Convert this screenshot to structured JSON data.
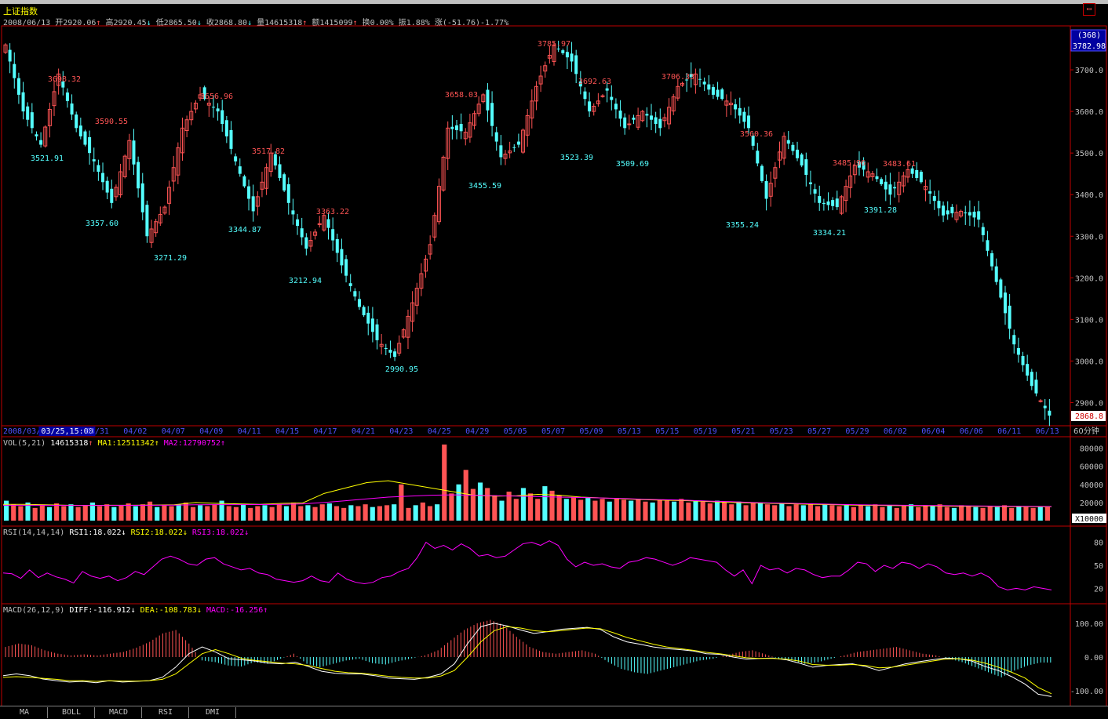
{
  "header": {
    "title": "上证指数",
    "date": "2008/06/13",
    "open": "开2920.06",
    "high": "高2920.45",
    "low": "低2865.50",
    "close": "收2868.80",
    "volume": "量14615318",
    "amount": "额1415099",
    "turnover": "换0.00%",
    "amplitude": "振1.88%",
    "change": "涨(-51.76)-1.77%",
    "count_badge": "(368)",
    "top_price": "3782.98",
    "last_price": "2868.8",
    "period": "60分钟"
  },
  "colors": {
    "up": "#ff5454",
    "down": "#54ffff",
    "ma1": "#ffff00",
    "ma2": "#ff00ff",
    "grid": "#c00000",
    "axis_text": "#c0c0c0"
  },
  "x_axis": {
    "labels": [
      "2008/03/21",
      "03/25,15:00",
      "03/31",
      "04/02",
      "04/07",
      "04/09",
      "04/11",
      "04/15",
      "04/17",
      "04/21",
      "04/23",
      "04/25",
      "04/29",
      "05/05",
      "05/07",
      "05/09",
      "05/13",
      "05/15",
      "05/19",
      "05/21",
      "05/23",
      "05/27",
      "05/29",
      "06/02",
      "06/04",
      "06/06",
      "06/11",
      "06/13"
    ]
  },
  "price_axis": {
    "ticks": [
      "3700.0",
      "3600.0",
      "3500.0",
      "3400.0",
      "3300.0",
      "3200.0",
      "3100.0",
      "3000.0",
      "2900.0"
    ]
  },
  "annotations": [
    {
      "text": "3698.32",
      "type": "high"
    },
    {
      "text": "3521.91",
      "type": "low"
    },
    {
      "text": "3590.55",
      "type": "high"
    },
    {
      "text": "3357.60",
      "type": "low"
    },
    {
      "text": "3271.29",
      "type": "low"
    },
    {
      "text": "3656.96",
      "type": "high"
    },
    {
      "text": "3344.87",
      "type": "low"
    },
    {
      "text": "3517.82",
      "type": "high"
    },
    {
      "text": "3363.22",
      "type": "high"
    },
    {
      "text": "3212.94",
      "type": "low"
    },
    {
      "text": "2990.95",
      "type": "low"
    },
    {
      "text": "3658.03",
      "type": "high"
    },
    {
      "text": "3455.59",
      "type": "low"
    },
    {
      "text": "3785.97",
      "type": "high"
    },
    {
      "text": "3692.63",
      "type": "high"
    },
    {
      "text": "3523.39",
      "type": "low"
    },
    {
      "text": "3509.69",
      "type": "low"
    },
    {
      "text": "3706.33",
      "type": "high"
    },
    {
      "text": "3560.36",
      "type": "high"
    },
    {
      "text": "3355.24",
      "type": "low"
    },
    {
      "text": "3485.96",
      "type": "high"
    },
    {
      "text": "3334.21",
      "type": "low"
    },
    {
      "text": "3483.61",
      "type": "high"
    },
    {
      "text": "3391.28",
      "type": "low"
    }
  ],
  "vol_panel": {
    "legend_name": "VOL(5,21)",
    "value": "14615318",
    "ma1": "MA1:12511342",
    "ma2": "MA2:12790752",
    "ticks": [
      "80000",
      "60000",
      "40000",
      "20000"
    ],
    "unit": "X10000"
  },
  "rsi_panel": {
    "legend_name": "RSI(14,14,14)",
    "rsi1": "RSI1:18.022",
    "rsi2": "RSI2:18.022",
    "rsi3": "RSI3:18.022",
    "ticks": [
      "80",
      "50",
      "20"
    ]
  },
  "macd_panel": {
    "legend_name": "MACD(26,12,9)",
    "diff": "DIFF:-116.912",
    "dea": "DEA:-108.783",
    "macd": "MACD:-16.256",
    "ticks": [
      "100.00",
      "0.00",
      "-100.00"
    ]
  },
  "tabs": [
    "MA",
    "BOLL",
    "MACD",
    "RSI",
    "DMI"
  ],
  "chart_data": [
    {
      "type": "candlestick",
      "title": "上证指数",
      "interval": "60分钟",
      "ylim": [
        2850,
        3800
      ],
      "close_path": [
        [
          "2008/03/21",
          3760
        ],
        [
          "03/25",
          3600
        ],
        [
          "03/25",
          3520
        ],
        [
          "03/27",
          3690
        ],
        [
          "03/31",
          3560
        ],
        [
          "03/31",
          3480
        ],
        [
          "04/01",
          3380
        ],
        [
          "04/02",
          3530
        ],
        [
          "04/02",
          3300
        ],
        [
          "04/03",
          3370
        ],
        [
          "04/07",
          3560
        ],
        [
          "04/07",
          3640
        ],
        [
          "04/08",
          3600
        ],
        [
          "04/09",
          3480
        ],
        [
          "04/10",
          3360
        ],
        [
          "04/11",
          3500
        ],
        [
          "04/14",
          3380
        ],
        [
          "04/15",
          3270
        ],
        [
          "04/16",
          3350
        ],
        [
          "04/17",
          3230
        ],
        [
          "04/18",
          3130
        ],
        [
          "04/21",
          3050
        ],
        [
          "04/22",
          3010
        ],
        [
          "04/22",
          3140
        ],
        [
          "04/23",
          3280
        ],
        [
          "04/24",
          3560
        ],
        [
          "04/25",
          3550
        ],
        [
          "04/25",
          3640
        ],
        [
          "04/28",
          3490
        ],
        [
          "04/29",
          3520
        ],
        [
          "04/30",
          3660
        ],
        [
          "05/05",
          3760
        ],
        [
          "05/06",
          3720
        ],
        [
          "05/07",
          3600
        ],
        [
          "05/08",
          3650
        ],
        [
          "05/09",
          3560
        ],
        [
          "05/12",
          3600
        ],
        [
          "05/13",
          3560
        ],
        [
          "05/14",
          3660
        ],
        [
          "05/15",
          3690
        ],
        [
          "05/16",
          3640
        ],
        [
          "05/19",
          3620
        ],
        [
          "05/20",
          3560
        ],
        [
          "05/21",
          3390
        ],
        [
          "05/22",
          3540
        ],
        [
          "05/23",
          3470
        ],
        [
          "05/26",
          3380
        ],
        [
          "05/27",
          3370
        ],
        [
          "05/28",
          3470
        ],
        [
          "05/29",
          3450
        ],
        [
          "05/30",
          3400
        ],
        [
          "06/02",
          3460
        ],
        [
          "06/03",
          3420
        ],
        [
          "06/04",
          3350
        ],
        [
          "06/05",
          3360
        ],
        [
          "06/06",
          3340
        ],
        [
          "06/10",
          3190
        ],
        [
          "06/11",
          3040
        ],
        [
          "06/12",
          2940
        ],
        [
          "06/13",
          2868.8
        ]
      ]
    },
    {
      "type": "bar",
      "title": "VOL(5,21)",
      "unit": "X10000",
      "ylim": [
        0,
        90000
      ],
      "values": [
        22000,
        18000,
        16000,
        20000,
        14000,
        17000,
        15000,
        19000,
        16000,
        18000,
        15000,
        17000,
        20000,
        16000,
        18000,
        15000,
        17000,
        19000,
        16000,
        18000,
        21000,
        15000,
        17000,
        16000,
        18000,
        20000,
        15000,
        17000,
        16000,
        18000,
        22000,
        16000,
        15000,
        18000,
        14000,
        16000,
        17000,
        15000,
        18000,
        16000,
        20000,
        16000,
        17000,
        15000,
        18000,
        19000,
        16000,
        14000,
        17000,
        16000,
        18000,
        15000,
        16000,
        17000,
        18000,
        40000,
        14000,
        17000,
        20000,
        16000,
        18000,
        84000,
        30000,
        40000,
        56000,
        35000,
        42000,
        36000,
        28000,
        22000,
        32000,
        24000,
        36000,
        30000,
        24000,
        38000,
        33000,
        28000,
        24000,
        26000,
        23000,
        25000,
        22000,
        24000,
        21000,
        25000,
        23000,
        22000,
        24000,
        21000,
        20000,
        23000,
        22000,
        21000,
        24000,
        20000,
        22000,
        21000,
        19000,
        22000,
        20000,
        18000,
        21000,
        17000,
        19000,
        20000,
        18000,
        17000,
        19000,
        16000,
        18000,
        17000,
        19000,
        16000,
        18000,
        17000,
        16000,
        18000,
        15000,
        17000,
        16000,
        18000,
        15000,
        17000,
        14000,
        16000,
        18000,
        15000,
        17000,
        16000,
        18000,
        15000,
        14000,
        17000,
        16000,
        15000,
        14000,
        16000,
        15000,
        17000,
        14000,
        16000,
        15000,
        14000,
        16000,
        15000
      ],
      "series": [
        {
          "name": "MA1",
          "values": [
            18000,
            18000,
            17500,
            17000,
            16800,
            17000,
            17000,
            17200,
            17500,
            20000,
            19000,
            18500,
            18000,
            19000,
            19500,
            30000,
            36000,
            42000,
            44000,
            40000,
            36000,
            32000,
            28000,
            27000,
            27500,
            29000,
            28000,
            26000,
            25000,
            24000,
            23000,
            22500,
            22000,
            21000,
            20000,
            19500,
            19000,
            18500,
            18000,
            17500,
            17000,
            16800,
            16500,
            16300,
            16000,
            15800,
            15800,
            15600,
            15500,
            15300
          ]
        },
        {
          "name": "MA2",
          "values": [
            17000,
            17000,
            17000,
            16800,
            16800,
            16800,
            16900,
            17000,
            17100,
            17500,
            17600,
            17600,
            17700,
            18000,
            18500,
            20000,
            22000,
            24000,
            26000,
            27000,
            28000,
            28500,
            28000,
            27500,
            27000,
            26500,
            26000,
            25500,
            25000,
            24500,
            23500,
            23000,
            22500,
            21500,
            21000,
            20000,
            19500,
            19000,
            18500,
            18000,
            17500,
            17200,
            17000,
            16800,
            16500,
            16300,
            16100,
            16000,
            15800,
            15600
          ]
        }
      ]
    },
    {
      "type": "line",
      "title": "RSI(14,14,14)",
      "ylim": [
        0,
        100
      ],
      "series": [
        {
          "name": "RSI1",
          "values": [
            40,
            39,
            33,
            44,
            34,
            40,
            35,
            32,
            27,
            42,
            36,
            33,
            36,
            30,
            34,
            42,
            38,
            48,
            58,
            62,
            58,
            52,
            50,
            58,
            60,
            52,
            48,
            44,
            46,
            40,
            38,
            32,
            30,
            28,
            30,
            36,
            30,
            28,
            40,
            32,
            28,
            26,
            28,
            34,
            36,
            42,
            46,
            60,
            80,
            72,
            76,
            70,
            78,
            72,
            62,
            64,
            60,
            62,
            70,
            78,
            80,
            76,
            82,
            76,
            58,
            48,
            54,
            50,
            52,
            48,
            46,
            54,
            56,
            60,
            58,
            54,
            50,
            54,
            60,
            58,
            56,
            54,
            44,
            36,
            44,
            26,
            50,
            44,
            46,
            40,
            46,
            44,
            38,
            34,
            36,
            36,
            44,
            54,
            52,
            42,
            50,
            46,
            54,
            52,
            46,
            52,
            48,
            40,
            38,
            40,
            36,
            40,
            34,
            22,
            18,
            20,
            18,
            22,
            20,
            18
          ]
        }
      ]
    },
    {
      "type": "line",
      "title": "MACD(26,12,9)",
      "ylim": [
        -130,
        130
      ],
      "series": [
        {
          "name": "DIFF",
          "values": [
            -55,
            -50,
            -55,
            -65,
            -70,
            -74,
            -72,
            -76,
            -70,
            -74,
            -72,
            -70,
            -60,
            -30,
            10,
            30,
            15,
            -5,
            -8,
            -12,
            -18,
            -20,
            -15,
            -28,
            -42,
            -48,
            -50,
            -50,
            -55,
            -62,
            -64,
            -66,
            -60,
            -50,
            -20,
            40,
            90,
            100,
            92,
            80,
            70,
            75,
            82,
            85,
            88,
            82,
            60,
            45,
            38,
            30,
            25,
            22,
            18,
            10,
            8,
            0,
            -6,
            -4,
            -3,
            -8,
            -18,
            -30,
            -25,
            -22,
            -20,
            -28,
            -40,
            -30,
            -20,
            -14,
            -8,
            -3,
            -5,
            -12,
            -28,
            -40,
            -58,
            -80,
            -110,
            -117
          ]
        },
        {
          "name": "DEA",
          "values": [
            -60,
            -58,
            -60,
            -63,
            -66,
            -70,
            -70,
            -72,
            -70,
            -71,
            -71,
            -70,
            -66,
            -50,
            -20,
            10,
            22,
            10,
            -4,
            -10,
            -14,
            -18,
            -20,
            -25,
            -34,
            -42,
            -46,
            -48,
            -52,
            -57,
            -60,
            -62,
            -62,
            -56,
            -40,
            0,
            45,
            78,
            90,
            86,
            78,
            75,
            78,
            82,
            86,
            84,
            72,
            58,
            48,
            38,
            30,
            25,
            20,
            14,
            10,
            4,
            -2,
            -4,
            -4,
            -6,
            -12,
            -22,
            -24,
            -24,
            -22,
            -25,
            -32,
            -30,
            -24,
            -18,
            -12,
            -6,
            -5,
            -9,
            -18,
            -30,
            -45,
            -62,
            -90,
            -108.783
          ]
        },
        {
          "name": "MACD",
          "values": [
            30,
            40,
            35,
            20,
            10,
            5,
            8,
            5,
            10,
            15,
            28,
            45,
            70,
            80,
            40,
            -10,
            -15,
            -25,
            -28,
            -15,
            -20,
            -5,
            10,
            -20,
            -30,
            -20,
            -10,
            -5,
            -18,
            -22,
            -12,
            -4,
            5,
            20,
            50,
            80,
            100,
            110,
            95,
            60,
            30,
            15,
            10,
            15,
            20,
            10,
            -15,
            -35,
            -45,
            -50,
            -40,
            -30,
            -20,
            -10,
            -5,
            5,
            15,
            20,
            8,
            -5,
            -10,
            -20,
            -15,
            -5,
            5,
            15,
            20,
            25,
            30,
            20,
            10,
            5,
            -5,
            -15,
            -30,
            -45,
            -60,
            -40,
            -25,
            -16.256
          ]
        }
      ]
    }
  ]
}
